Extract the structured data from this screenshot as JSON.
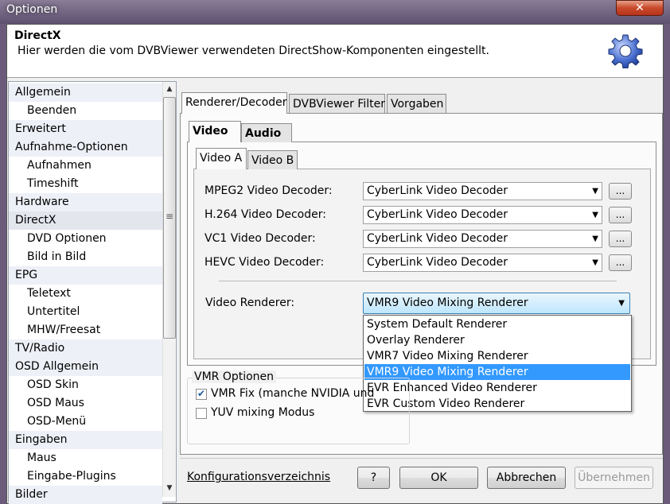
{
  "window": {
    "title": "Optionen",
    "close_label": "✕"
  },
  "header": {
    "title": "DirectX",
    "description": "Hier werden die vom DVBViewer verwendeten DirectShow-Komponenten eingestellt."
  },
  "sidebar": {
    "items": [
      {
        "label": "Allgemein",
        "level": 0
      },
      {
        "label": "Beenden",
        "level": 1
      },
      {
        "label": "Erweitert",
        "level": 0
      },
      {
        "label": "Aufnahme-Optionen",
        "level": 0
      },
      {
        "label": "Aufnahmen",
        "level": 1
      },
      {
        "label": "Timeshift",
        "level": 1
      },
      {
        "label": "Hardware",
        "level": 0
      },
      {
        "label": "DirectX",
        "level": 0,
        "selected": true
      },
      {
        "label": "DVD Optionen",
        "level": 1
      },
      {
        "label": "Bild in Bild",
        "level": 1
      },
      {
        "label": "EPG",
        "level": 0
      },
      {
        "label": "Teletext",
        "level": 1
      },
      {
        "label": "Untertitel",
        "level": 1
      },
      {
        "label": "MHW/Freesat",
        "level": 1
      },
      {
        "label": "TV/Radio",
        "level": 0
      },
      {
        "label": "OSD Allgemein",
        "level": 0
      },
      {
        "label": "OSD Skin",
        "level": 1
      },
      {
        "label": "OSD Maus",
        "level": 1
      },
      {
        "label": "OSD-Menü",
        "level": 1
      },
      {
        "label": "Eingaben",
        "level": 0
      },
      {
        "label": "Maus",
        "level": 1
      },
      {
        "label": "Eingabe-Plugins",
        "level": 1
      },
      {
        "label": "Bilder",
        "level": 0
      }
    ]
  },
  "tabs": {
    "main": [
      "Renderer/Decoder",
      "DVBViewer Filter",
      "Vorgaben"
    ],
    "sub": [
      "Video",
      "Audio"
    ],
    "video": [
      "Video A",
      "Video B"
    ]
  },
  "decoders": [
    {
      "label": "MPEG2 Video Decoder:",
      "value": "CyberLink Video Decoder"
    },
    {
      "label": "H.264 Video Decoder:",
      "value": "CyberLink Video Decoder"
    },
    {
      "label": "VC1 Video Decoder:",
      "value": "CyberLink Video Decoder"
    },
    {
      "label": "HEVC Video Decoder:",
      "value": "CyberLink Video Decoder"
    }
  ],
  "dots_label": "...",
  "renderer": {
    "label": "Video Renderer:",
    "value": "VMR9 Video Mixing Renderer",
    "options": [
      "System Default Renderer",
      "Overlay Renderer",
      "VMR7 Video Mixing Renderer",
      "VMR9 Video Mixing Renderer",
      "EVR Enhanced Video Renderer",
      "EVR Custom Video Renderer"
    ],
    "selected_index": 3
  },
  "vmr": {
    "title": "VMR Optionen",
    "fix_label": "VMR Fix (manche NVIDIA und",
    "fix_checked": true,
    "yuv_label": "YUV mixing Modus",
    "yuv_checked": false
  },
  "footer": {
    "config_link": "Konfigurationsverzeichnis",
    "help": "?",
    "ok": "OK",
    "cancel": "Abbrechen",
    "apply": "Übernehmen"
  }
}
